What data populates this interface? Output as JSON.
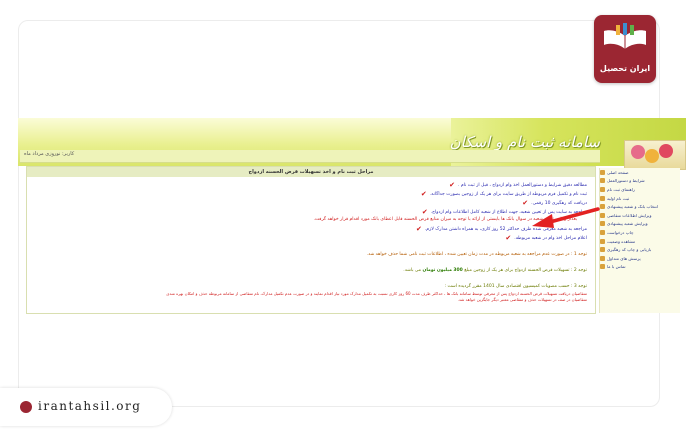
{
  "header": {
    "title_art": "سامانه ثبت نام و اسکان",
    "user_info": "کاربر: نوروزی مرداد ماه"
  },
  "logo": {
    "text": "ایران تحصیل",
    "color": "#9b2632"
  },
  "footer": {
    "url": "irantahsil.org"
  },
  "content": {
    "header": "مراحل ثبت نام و اخذ تسهیلات قرض الحسنه ازدواج",
    "steps": [
      "مطالعه دقیق شرایط و دستورالعمل اخذ وام ازدواج ، قبل از ثبت نام .",
      "ثبت نام و تکمیل فرم مربوطه از طریق سایت برای هر یک از زوجین بصورت جداگانه.",
      "دریافت کد رهگیری 10 رقمی.",
      "مراجعه به سایت پس از تعیین شعبه، جهت اطلاع از شعبه کامل اطلاعات وام ازدواج.",
      "مراجعه به شعبه معرفی شده ظرف حداکثر 52 روز کاری، به همراه داشتن مدارک لازم.",
      "اعلام مراحل اخذ وام در شعبه مربوطه."
    ],
    "red_note": "بعداز زمانی تعیین شعبه در سوال بانک ها بایستی از ارائه با توجه به میزان منابع قرض الحسنه قابل اعطای بانک مورد اقدام قرار خواهد گرفت.",
    "notes": [
      "توجه 1 : در صورت عدم مراجعه به شعبه مربوطه در مدت زمان تعیین شده ، اطلاعات ثبت نامی شما حذف خواهد شد.",
      "توجه 2 : تسهیلات قرض الحسنه ازدواج برای هر یک از زوجین مبلغ",
      "300 میلیون تومان",
      "می باشد.",
      "توجه 3 : حسب مصوبات کمیسیون اقتصادی سال 1401 مقرر گردیده است :",
      "متقاضیان دریافت تسهیلات قرض الحسنه ازدواج پس از معرفی توسط سامانه بانک ها ، حداکثر ظرف مدت 60 روز کاری نسبت به تکمیل مدارک مورد نیاز اقدام نمایند و در صورت عدم تکمیل مدارک، نام متقاضی از سامانه مربوطه حذف و امکان بهره مندی",
      "متقاضیان در صف در تسهیلات حذف و متقاضی معتبر دیگر جایگزین خواهد شد."
    ]
  },
  "sidebar": {
    "items": [
      "صفحه اصلی",
      "شرایط و دستورالعمل",
      "راهنمای ثبت نام",
      "ثبت نام اولیه",
      "انتخاب بانک و شعبه پیشنهادی",
      "ویرایش اطلاعات متقاضی",
      "ویرایش شعبه پیشنهادی",
      "چاپ درخواست",
      "مشاهده وضعیت",
      "بازیابی و چاپ کد رهگیری",
      "پرسش های متداول",
      "تماس با ما"
    ]
  },
  "colors": {
    "accent_red": "#d01c1c",
    "link_blue": "#2b2bb0",
    "band_green": "#d9e56a"
  }
}
